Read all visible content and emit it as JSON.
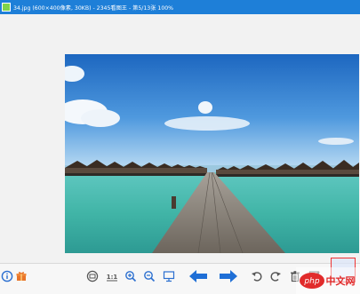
{
  "window": {
    "title": "34.jpg (600×400像素, 30KB) - 2345看图王 - 第5/13张 100%"
  },
  "photo": {
    "description_icon": "image-viewer-photo"
  },
  "toolbar": {
    "items": [
      {
        "name": "info-icon"
      },
      {
        "name": "gift-icon"
      },
      {
        "name": "fit-window-icon"
      },
      {
        "name": "actual-size-icon",
        "label": "1:1"
      },
      {
        "name": "zoom-in-icon"
      },
      {
        "name": "zoom-out-icon"
      },
      {
        "name": "slideshow-icon"
      },
      {
        "name": "previous-arrow-icon"
      },
      {
        "name": "next-arrow-icon"
      },
      {
        "name": "rotate-left-icon"
      },
      {
        "name": "rotate-right-icon"
      },
      {
        "name": "delete-icon"
      },
      {
        "name": "edit-icon"
      }
    ]
  },
  "colors": {
    "titlebar": "#1e7fd8",
    "accent": "#2b6fd0",
    "watermark_red": "#e12b2b"
  },
  "watermark": {
    "text": "php中文网"
  }
}
